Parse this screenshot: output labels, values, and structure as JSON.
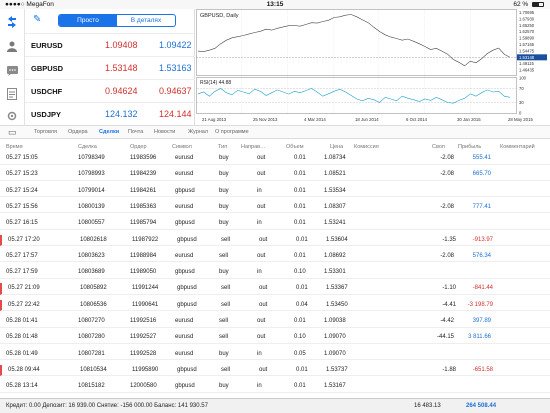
{
  "status": {
    "carrier": "●●●●○ MegaFon",
    "time": "13:15",
    "battery": "62 %",
    "battery_level": 0.62
  },
  "quotes": {
    "tabs": [
      {
        "label": "Просто",
        "active": true
      },
      {
        "label": "В деталях",
        "active": false
      }
    ],
    "rows": [
      {
        "symbol": "EURUSD",
        "bid": "1.09408",
        "ask": "1.09422",
        "bid_color": "red",
        "ask_color": "blue"
      },
      {
        "symbol": "GBPUSD",
        "bid": "1.53148",
        "ask": "1.53163",
        "bid_color": "red",
        "ask_color": "blue"
      },
      {
        "symbol": "USDCHF",
        "bid": "0.94624",
        "ask": "0.94637",
        "bid_color": "red",
        "ask_color": "red"
      },
      {
        "symbol": "USDJPY",
        "bid": "124.132",
        "ask": "124.144",
        "bid_color": "blue",
        "ask_color": "red"
      }
    ]
  },
  "chart": {
    "title": "GBPUSD, Daily",
    "indicator": "RSI(14) 44.88",
    "price_axis": [
      "1.70695",
      "1.67930",
      "1.65250",
      "1.62570",
      "1.59890",
      "1.57155",
      "1.54475",
      "1.51795",
      "1.49115",
      "1.46435"
    ],
    "current_price": "1.53148",
    "rsi_axis": [
      "100",
      "70",
      "30",
      "0"
    ],
    "dates": [
      "21 Aug 2013",
      "25 Nov 2013",
      "4 Mar 2014",
      "18 Jun 2014",
      "6 Oct 2014",
      "30 Jan 2015",
      "28 May 2015"
    ],
    "series": [
      1.558,
      1.556,
      1.562,
      1.57,
      1.59,
      1.605,
      1.615,
      1.62,
      1.625,
      1.632,
      1.638,
      1.643,
      1.652,
      1.648,
      1.656,
      1.662,
      1.667,
      1.668,
      1.665,
      1.672,
      1.68,
      1.678,
      1.685,
      1.69,
      1.702,
      1.705,
      1.712,
      1.715,
      1.705,
      1.692,
      1.68,
      1.66,
      1.642,
      1.628,
      1.618,
      1.612,
      1.605,
      1.61,
      1.6,
      1.59,
      1.578,
      1.565,
      1.57,
      1.558,
      1.545,
      1.522,
      1.51,
      1.495,
      1.515,
      1.508,
      1.525,
      1.548,
      1.562,
      1.571,
      1.545,
      1.531
    ],
    "rsi": [
      55,
      60,
      48,
      62,
      70,
      58,
      52,
      65,
      60,
      55,
      68,
      62,
      50,
      58,
      66,
      60,
      54,
      62,
      58,
      64,
      70,
      60,
      48,
      55,
      62,
      68,
      60,
      50,
      40,
      35,
      42,
      38,
      30,
      45,
      40,
      35,
      48,
      42,
      38,
      33,
      40,
      36,
      45,
      38,
      30,
      28,
      36,
      42,
      55,
      48,
      58,
      66,
      60,
      62,
      48,
      44.88
    ]
  },
  "tabs": [
    {
      "label": "Торговля",
      "active": false
    },
    {
      "label": "Ордера",
      "active": false
    },
    {
      "label": "Сделки",
      "active": true
    },
    {
      "label": "Почта",
      "active": false
    },
    {
      "label": "Новости",
      "active": false
    },
    {
      "label": "Журнал",
      "active": false
    },
    {
      "label": "О программе",
      "active": false
    }
  ],
  "table": {
    "headers": [
      "Время",
      "Сделка",
      "Ордер",
      "Символ",
      "Тип",
      "Направ…",
      "Объем",
      "Цена",
      "Комиссия",
      "Своп",
      "Прибыль",
      "Комментарий"
    ],
    "rows": [
      {
        "time": "05.27 15:05",
        "deal": "10798349",
        "order": "11983596",
        "symbol": "eurusd",
        "type": "buy",
        "dir": "out",
        "vol": "0.01",
        "price": "1.08734",
        "comm": "",
        "swap": "-2.08",
        "profit": "555.41",
        "marked": false
      },
      {
        "time": "05.27 15:23",
        "deal": "10798993",
        "order": "11984239",
        "symbol": "eurusd",
        "type": "buy",
        "dir": "out",
        "vol": "0.01",
        "price": "1.08521",
        "comm": "",
        "swap": "-2.08",
        "profit": "665.70",
        "marked": false
      },
      {
        "time": "05.27 15:24",
        "deal": "10799014",
        "order": "11984261",
        "symbol": "gbpusd",
        "type": "buy",
        "dir": "in",
        "vol": "0.01",
        "price": "1.53534",
        "comm": "",
        "swap": "",
        "profit": "",
        "marked": false
      },
      {
        "time": "05.27 15:56",
        "deal": "10800139",
        "order": "11985363",
        "symbol": "eurusd",
        "type": "buy",
        "dir": "out",
        "vol": "0.01",
        "price": "1.08307",
        "comm": "",
        "swap": "-2.08",
        "profit": "777.41",
        "marked": false
      },
      {
        "time": "05.27 16:15",
        "deal": "10800557",
        "order": "11985794",
        "symbol": "gbpusd",
        "type": "buy",
        "dir": "in",
        "vol": "0.01",
        "price": "1.53241",
        "comm": "",
        "swap": "",
        "profit": "",
        "marked": false
      },
      {
        "time": "05.27 17:20",
        "deal": "10802618",
        "order": "11987922",
        "symbol": "gbpusd",
        "type": "sell",
        "dir": "out",
        "vol": "0.01",
        "price": "1.53604",
        "comm": "",
        "swap": "-1.35",
        "profit": "-913.97",
        "marked": true
      },
      {
        "time": "05.27 17:57",
        "deal": "10803623",
        "order": "11988984",
        "symbol": "eurusd",
        "type": "sell",
        "dir": "out",
        "vol": "0.01",
        "price": "1.08692",
        "comm": "",
        "swap": "-2.08",
        "profit": "576.34",
        "marked": false
      },
      {
        "time": "05.27 17:59",
        "deal": "10803689",
        "order": "11989050",
        "symbol": "gbpusd",
        "type": "buy",
        "dir": "in",
        "vol": "0.10",
        "price": "1.53301",
        "comm": "",
        "swap": "",
        "profit": "",
        "marked": false
      },
      {
        "time": "05.27 21:09",
        "deal": "10805892",
        "order": "11991244",
        "symbol": "gbpusd",
        "type": "sell",
        "dir": "out",
        "vol": "0.01",
        "price": "1.53367",
        "comm": "",
        "swap": "-1.10",
        "profit": "-841.44",
        "marked": true
      },
      {
        "time": "05.27 22:42",
        "deal": "10806536",
        "order": "11990641",
        "symbol": "gbpusd",
        "type": "sell",
        "dir": "out",
        "vol": "0.04",
        "price": "1.53450",
        "comm": "",
        "swap": "-4.41",
        "profit": "-3 198.79",
        "marked": true
      },
      {
        "time": "05.28 01:41",
        "deal": "10807270",
        "order": "11992516",
        "symbol": "eurusd",
        "type": "sell",
        "dir": "out",
        "vol": "0.01",
        "price": "1.09038",
        "comm": "",
        "swap": "-4.42",
        "profit": "397.89",
        "marked": false
      },
      {
        "time": "05.28 01:48",
        "deal": "10807280",
        "order": "11992527",
        "symbol": "eurusd",
        "type": "sell",
        "dir": "out",
        "vol": "0.10",
        "price": "1.09070",
        "comm": "",
        "swap": "-44.15",
        "profit": "3 811.66",
        "marked": false
      },
      {
        "time": "05.28 01:49",
        "deal": "10807281",
        "order": "11992528",
        "symbol": "eurusd",
        "type": "buy",
        "dir": "in",
        "vol": "0.05",
        "price": "1.09070",
        "comm": "",
        "swap": "",
        "profit": "",
        "marked": false
      },
      {
        "time": "05.28 09:44",
        "deal": "10810534",
        "order": "11995890",
        "symbol": "gbpusd",
        "type": "sell",
        "dir": "out",
        "vol": "0.01",
        "price": "1.53737",
        "comm": "",
        "swap": "-1.88",
        "profit": "-651.58",
        "marked": true
      },
      {
        "time": "05.28 13:14",
        "deal": "10815182",
        "order": "12000580",
        "symbol": "gbpusd",
        "type": "buy",
        "dir": "in",
        "vol": "0.01",
        "price": "1.53167",
        "comm": "",
        "swap": "",
        "profit": "",
        "marked": false
      }
    ]
  },
  "footer": {
    "summary": "Кредит: 0.00 Депозит: 16 939.00 Снятие: -156 000.00 Баланс: 141 930.57",
    "swap_total": "16 483.13",
    "profit_total": "264 508.44"
  },
  "colors": {
    "accent": "#1a73e8",
    "loss": "#d0312d",
    "profit": "#1a6fd4",
    "marker": "#e24b4b"
  }
}
